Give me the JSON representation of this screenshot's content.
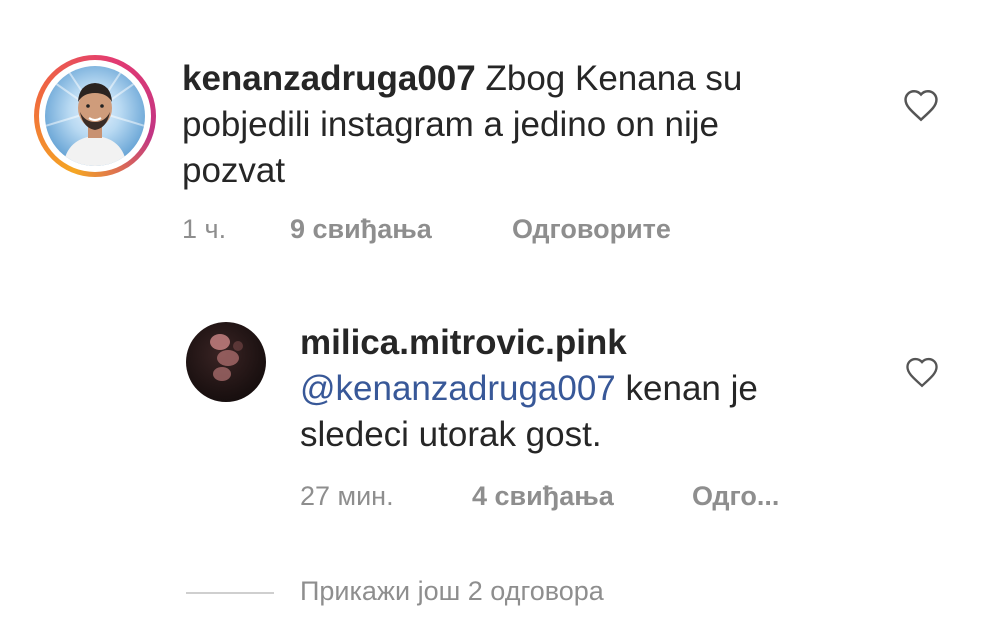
{
  "main_comment": {
    "username": "kenanzadruga007",
    "text_line1": "Zbog Kenana su",
    "text_line2": "pobjedili instagram a jedino on nije",
    "text_line3": "pozvat",
    "time": "1 ч.",
    "likes": "9 свиђања",
    "reply": "Одговорите",
    "like_icon": "heart-outline-icon",
    "avatar_story_ring": true
  },
  "reply_comment": {
    "username": "milica.mitrovic.pink",
    "mention": "@kenanzadruga007",
    "text_line1_rest": "kenan je",
    "text_line2": "sledeci utorak gost.",
    "time": "27 мин.",
    "likes": "4 свиђања",
    "reply": "Одго...",
    "like_icon": "heart-outline-icon"
  },
  "view_more_replies": "Прикажи још 2 одговора",
  "colors": {
    "text": "#262626",
    "secondary": "#8e8e8e",
    "mention": "#385898",
    "story_ring": [
      "#f5a623",
      "#e23a72",
      "#c13584"
    ]
  }
}
